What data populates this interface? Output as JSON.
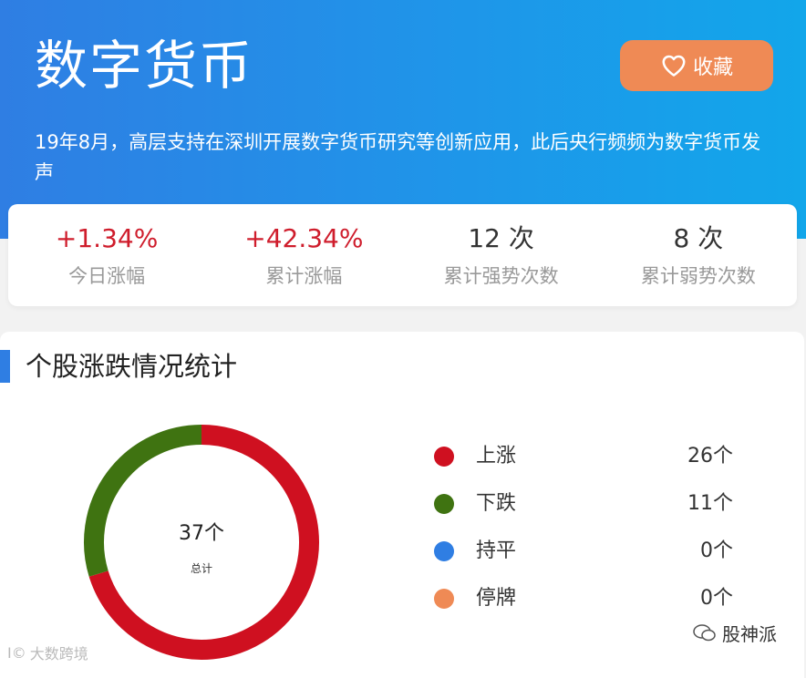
{
  "header": {
    "title": "数字货币",
    "favorite_label": "收藏",
    "description": "19年8月，高层支持在深圳开展数字货币研究等创新应用，此后央行频频为数字货币发声"
  },
  "stats": [
    {
      "value": "+1.34%",
      "label": "今日涨幅"
    },
    {
      "value": "+42.34%",
      "label": "累计涨幅"
    },
    {
      "value": "12 次",
      "label": "累计强势次数"
    },
    {
      "value": "8 次",
      "label": "累计弱势次数"
    }
  ],
  "section": {
    "title": "个股涨跌情况统计"
  },
  "donut": {
    "center_value": "37个",
    "center_label": "总计"
  },
  "chart_data": {
    "type": "pie",
    "categories": [
      "上涨",
      "下跌",
      "持平",
      "停牌"
    ],
    "values": [
      26,
      11,
      0,
      0
    ],
    "colors": [
      "#cf1020",
      "#3f7311",
      "#2f7ee3",
      "#ef8a55"
    ]
  },
  "legend": [
    {
      "label": "上涨",
      "count": "26个"
    },
    {
      "label": "下跌",
      "count": "11个"
    },
    {
      "label": "持平",
      "count": "0个"
    },
    {
      "label": "停牌",
      "count": "0个"
    }
  ],
  "watermarks": {
    "right": "股神派",
    "left": "大数跨境"
  },
  "colors": {
    "accent": "#2f7ee3",
    "up": "#cf1d2c",
    "button": "#ef8a55"
  }
}
